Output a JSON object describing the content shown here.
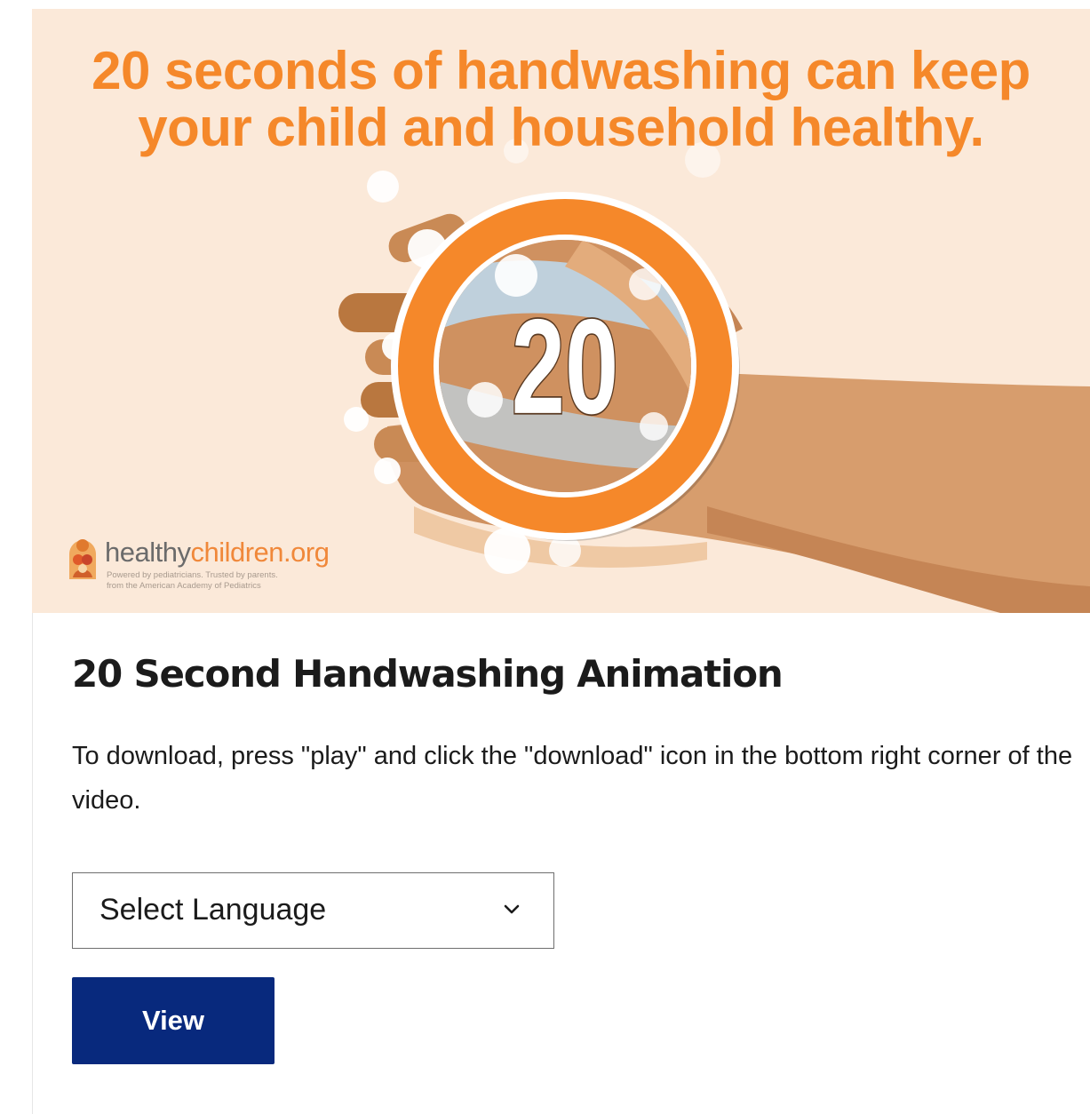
{
  "thumbnail": {
    "headline_line1": "20 seconds of handwashing can keep",
    "headline_line2": "your child and household healthy.",
    "timer_number": "20",
    "logo_word1": "healthy",
    "logo_word2": "children.org",
    "logo_tagline1": "Powered by pediatricians. Trusted by parents.",
    "logo_tagline2": "from the American Academy of Pediatrics",
    "colors": {
      "background": "#fbe9d9",
      "accent_orange": "#f5882a",
      "skin": "#d79d6d"
    }
  },
  "title": "20 Second Handwashing Animation",
  "description": "To download, press \"play\" and click the \"download\" icon in the bottom right corner of the video.",
  "language_select": {
    "label": "Select Language",
    "icon": "chevron-down-icon"
  },
  "view_button": {
    "label": "View",
    "color": "#08297d"
  }
}
